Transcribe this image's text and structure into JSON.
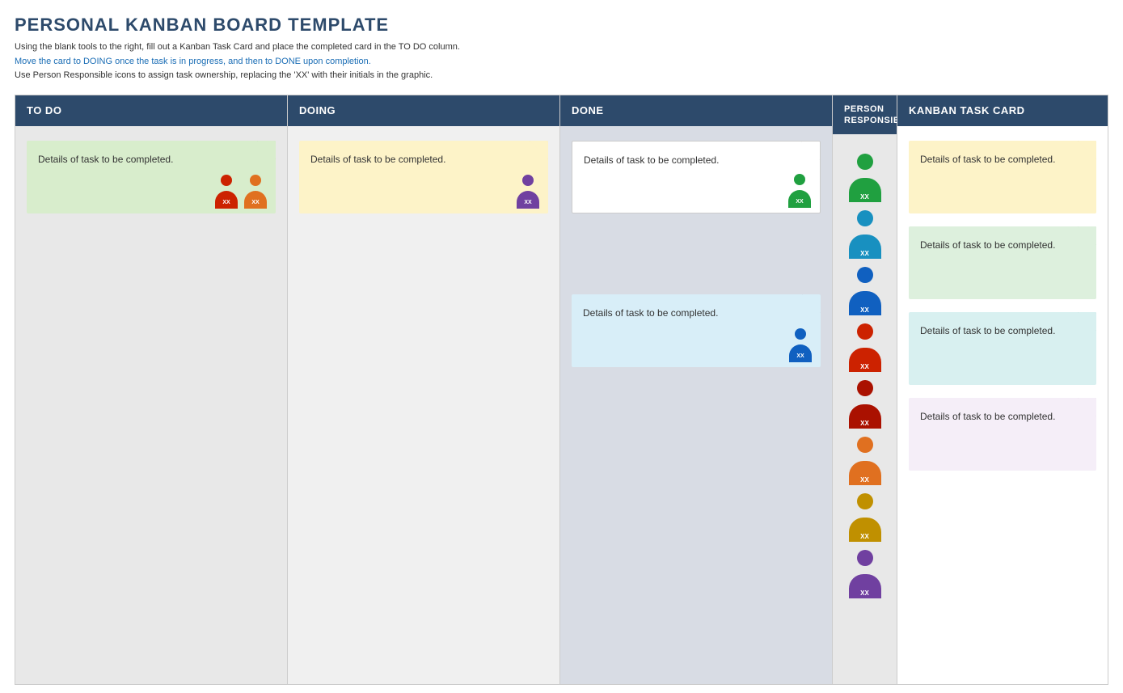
{
  "title": "PERSONAL KANBAN BOARD TEMPLATE",
  "instructions": {
    "line1": "Using the blank tools to the right, fill out a Kanban Task Card and place the completed card in the TO DO column.",
    "line2": "Move the card to DOING once the task is in progress, and then to DONE upon completion.",
    "line3": "Use Person Responsible icons to assign task ownership, replacing the 'XX' with their initials in the graphic."
  },
  "columns": {
    "todo": {
      "header": "TO DO"
    },
    "doing": {
      "header": "DOING"
    },
    "done": {
      "header": "DONE"
    },
    "person": {
      "header": "PERSON\nRESPONSIBLE"
    },
    "kanban": {
      "header": "KANBAN TASK CARD"
    }
  },
  "cards": {
    "todo_card1": "Details of task to be completed.",
    "doing_card1": "Details of task to be completed.",
    "done_card1": "Details of task to be completed.",
    "done_card2": "Details of task to be completed.",
    "kanban_card1": "Details of task to be completed.",
    "kanban_card2": "Details of task to be completed.",
    "kanban_card3": "Details of task to be completed.",
    "kanban_card4": "Details of task to be completed."
  },
  "avatars": {
    "label": "XX"
  },
  "colors": {
    "red": "#cc2200",
    "orange": "#e07020",
    "purple": "#7040a0",
    "green": "#20a040",
    "blue": "#1060c0",
    "dark_red": "#aa1100",
    "gold": "#c09000",
    "cyan_blue": "#1890c0"
  }
}
